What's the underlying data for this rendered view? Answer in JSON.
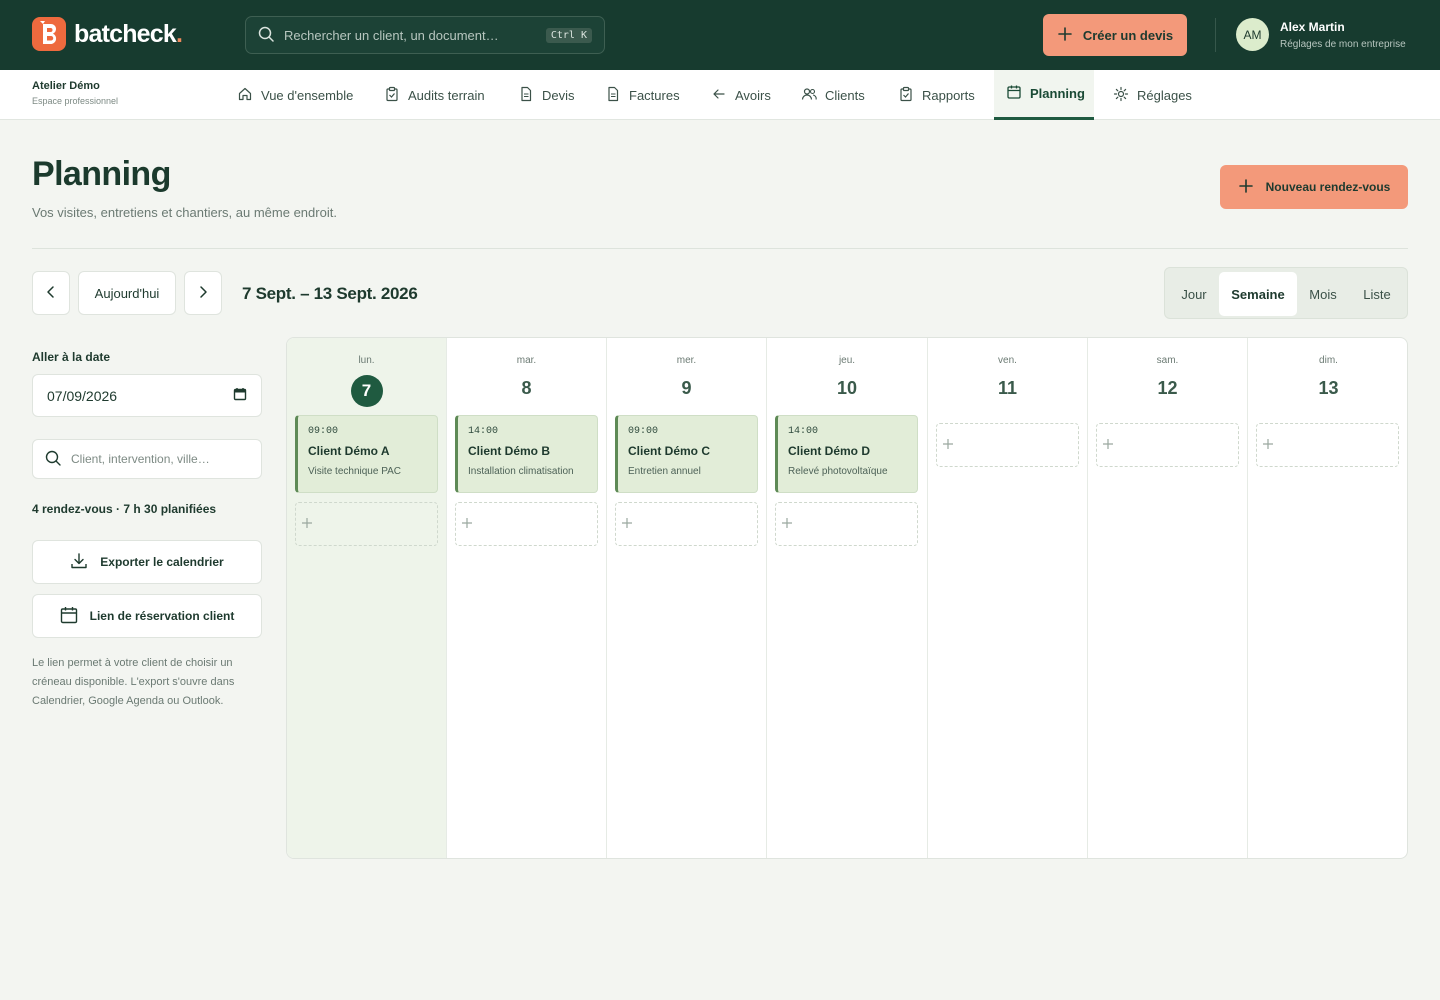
{
  "brand": {
    "name": "batcheck",
    "dot": "."
  },
  "search": {
    "placeholder": "Rechercher un client, un document…",
    "shortcut": "Ctrl K"
  },
  "header_actions": {
    "create_quote": "Créer un devis"
  },
  "user": {
    "initials": "AM",
    "name": "Alex Martin",
    "subtitle": "Réglages de mon entreprise"
  },
  "workspace": {
    "name": "Atelier Démo",
    "type": "Espace professionnel"
  },
  "nav": {
    "tabs": [
      {
        "label": "Vue d'ensemble",
        "icon": "home-icon"
      },
      {
        "label": "Audits terrain",
        "icon": "clipboard-icon"
      },
      {
        "label": "Devis",
        "icon": "document-icon"
      },
      {
        "label": "Factures",
        "icon": "document-icon"
      },
      {
        "label": "Avoirs",
        "icon": "arrow-left-icon"
      },
      {
        "label": "Clients",
        "icon": "users-icon"
      },
      {
        "label": "Rapports",
        "icon": "clipboard-check-icon"
      },
      {
        "label": "Planning",
        "icon": "calendar-icon",
        "active": true
      },
      {
        "label": "Réglages",
        "icon": "gear-icon"
      }
    ]
  },
  "page": {
    "title": "Planning",
    "subtitle": "Vos visites, entretiens et chantiers, au même endroit.",
    "new_appointment": "Nouveau rendez-vous"
  },
  "toolbar": {
    "today": "Aujourd'hui",
    "range": "7 Sept. – 13 Sept. 2026",
    "views": [
      "Jour",
      "Semaine",
      "Mois",
      "Liste"
    ],
    "active_view": "Semaine"
  },
  "sidebar": {
    "goto_label": "Aller à la date",
    "date_value": "07/09/2026",
    "search_placeholder": "Client, intervention, ville…",
    "summary": "4 rendez-vous · 7 h 30 planifiées",
    "export_label": "Exporter le calendrier",
    "booking_label": "Lien de réservation client",
    "note": "Le lien permet à votre client de choisir un créneau disponible. L'export s'ouvre dans Calendrier, Google Agenda ou Outlook."
  },
  "calendar": {
    "days": [
      {
        "dow": "lun.",
        "num": "7",
        "today": true,
        "event": {
          "time": "09:00",
          "client": "Client Démo A",
          "type": "Visite technique PAC"
        }
      },
      {
        "dow": "mar.",
        "num": "8",
        "event": {
          "time": "14:00",
          "client": "Client Démo B",
          "type": "Installation climatisation"
        }
      },
      {
        "dow": "mer.",
        "num": "9",
        "event": {
          "time": "09:00",
          "client": "Client Démo C",
          "type": "Entretien annuel"
        }
      },
      {
        "dow": "jeu.",
        "num": "10",
        "event": {
          "time": "14:00",
          "client": "Client Démo D",
          "type": "Relevé photovoltaïque"
        }
      },
      {
        "dow": "ven.",
        "num": "11"
      },
      {
        "dow": "sam.",
        "num": "12"
      },
      {
        "dow": "dim.",
        "num": "13"
      }
    ]
  },
  "colors": {
    "primary": "#173b2f",
    "accent": "#f3997a",
    "brand_orange": "#ee6a3e",
    "today_bg": "#eef4ea",
    "event_bg": "#e2edd8"
  }
}
